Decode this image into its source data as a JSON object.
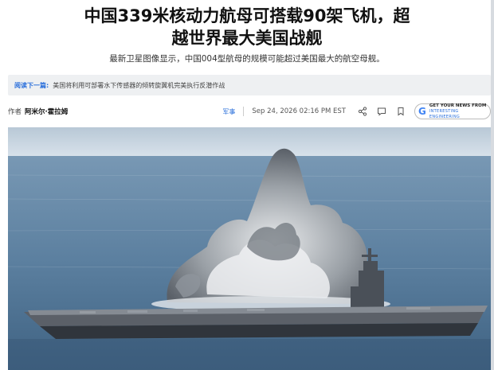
{
  "article": {
    "headline_line1": "中国339米核动力航母可搭载90架飞机，超",
    "headline_line2": "越世界最大美国战舰",
    "subtitle": "最新卫星图像显示，中国004型航母的规模可能超过美国最大的航空母舰。"
  },
  "read_next": {
    "label": "阅读下一篇:",
    "text": "美国将利用可部署水下传感器的倾转旋翼机完美执行反潜作战"
  },
  "meta": {
    "author_label": "作者",
    "author": "阿米尔·霍拉姆",
    "category": "军事",
    "date": "Sep 24, 2026 02:16 PM EST",
    "google_badge_line1": "GET YOUR NEWS FROM",
    "google_badge_line2": "INTERESTING ENGINEERING",
    "google_badge_logo": "G"
  },
  "icons": [
    "share-icon",
    "comment-icon",
    "bookmark-icon",
    "google-logo-icon"
  ],
  "colors": {
    "accent": "#2a6fdb",
    "sea": "#5f86a8",
    "sky": "#c9d7e3"
  }
}
